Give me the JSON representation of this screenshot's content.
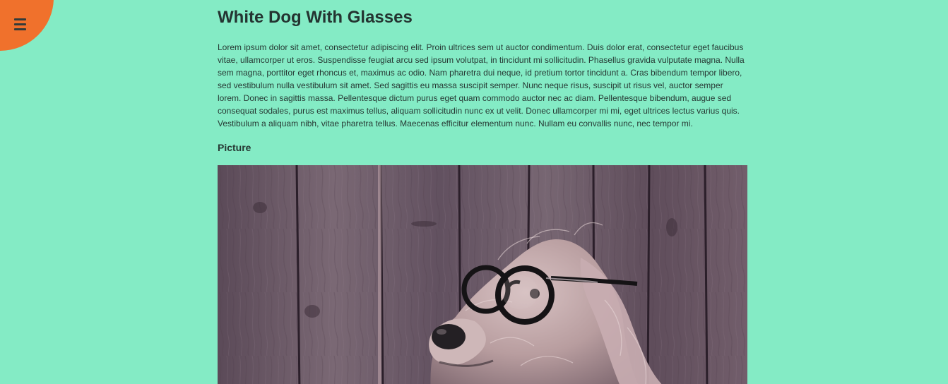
{
  "article": {
    "title": "White Dog With Glasses",
    "body": "Lorem ipsum dolor sit amet, consectetur adipiscing elit. Proin ultrices sem ut auctor condimentum. Duis dolor erat, consectetur eget faucibus vitae, ullamcorper ut eros. Suspendisse feugiat arcu sed ipsum volutpat, in tincidunt mi sollicitudin. Phasellus gravida vulputate magna. Nulla sem magna, porttitor eget rhoncus et, maximus ac odio. Nam pharetra dui neque, id pretium tortor tincidunt a. Cras bibendum tempor libero, sed vestibulum nulla vestibulum sit amet. Sed sagittis eu massa suscipit semper. Nunc neque risus, suscipit ut risus vel, auctor semper lorem. Donec in sagittis massa. Pellentesque dictum purus eget quam commodo auctor nec ac diam. Pellentesque bibendum, augue sed consequat sodales, purus est maximus tellus, aliquam sollicitudin nunc ex ut velit. Donec ullamcorper mi mi, eget ultrices lectus varius quis. Vestibulum a aliquam nibh, vitae pharetra tellus. Maecenas efficitur elementum nunc. Nullam eu convallis nunc, nec tempor mi.",
    "section_heading": "Picture"
  },
  "menu": {
    "icon": "hamburger-menu-icon"
  },
  "colors": {
    "background": "#84ebc5",
    "menu_blob": "#f0712c",
    "text": "#263833"
  }
}
